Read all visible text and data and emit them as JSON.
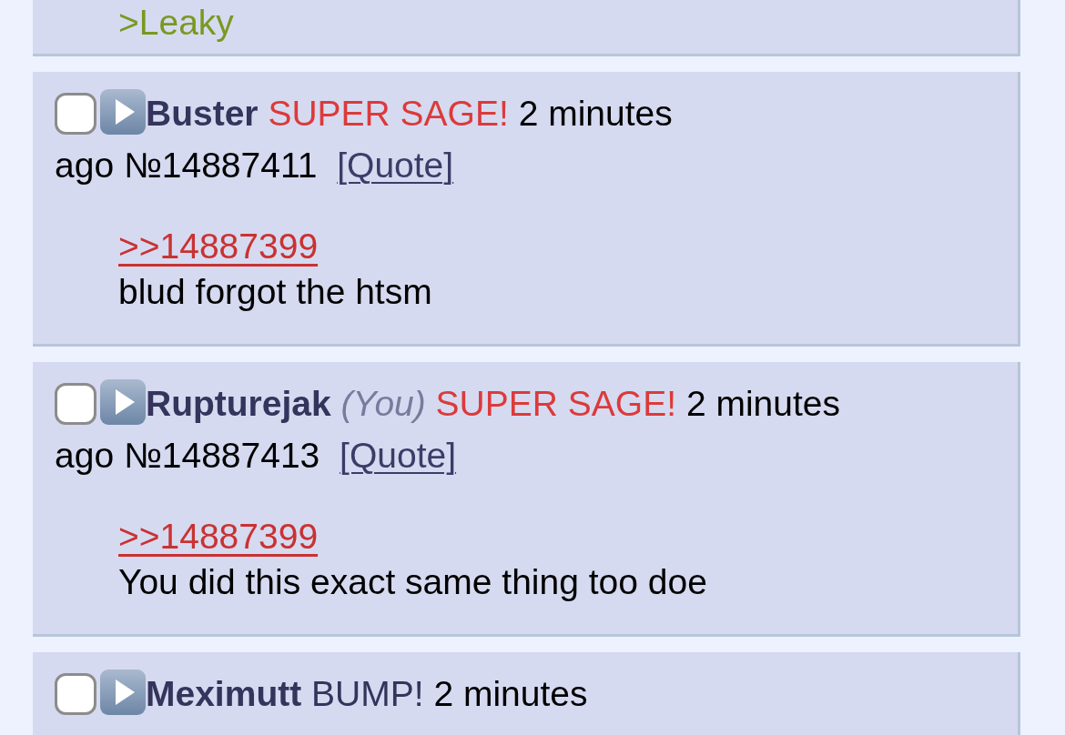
{
  "posts": [
    {
      "message": [
        {
          "kind": "greentext",
          "text": ">Leaky"
        }
      ]
    },
    {
      "checked": false,
      "name": "Buster",
      "tag": {
        "kind": "sage",
        "text": "SUPER SAGE!"
      },
      "time_parts": [
        "2 minutes",
        "ago"
      ],
      "number": "№14887411",
      "quote_button": "[Quote]",
      "message": [
        {
          "kind": "quotelink",
          "text": ">>14887399"
        },
        {
          "kind": "text",
          "text": "blud forgot the htsm"
        }
      ]
    },
    {
      "checked": false,
      "name": "Rupturejak",
      "you": "(You)",
      "tag": {
        "kind": "sage",
        "text": "SUPER SAGE!"
      },
      "time_parts": [
        "2 minutes",
        "ago"
      ],
      "number": "№14887413",
      "quote_button": "[Quote]",
      "message": [
        {
          "kind": "quotelink",
          "text": ">>14887399"
        },
        {
          "kind": "text",
          "text": "You did this exact same thing too doe"
        }
      ]
    },
    {
      "checked": false,
      "name": "Meximutt",
      "tag": {
        "kind": "bump",
        "text": "BUMP!"
      },
      "time_parts": [
        "2 minutes"
      ]
    }
  ]
}
